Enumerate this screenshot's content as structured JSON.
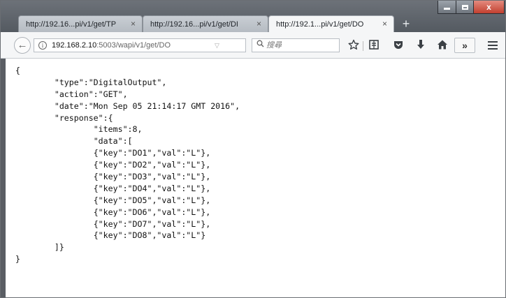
{
  "tabs": [
    {
      "label": "http://192.16...pi/v1/get/TP",
      "close": "×",
      "active": false
    },
    {
      "label": "http://192.16...pi/v1/get/DI",
      "close": "×",
      "active": false
    },
    {
      "label": "http://192.1...pi/v1/get/DO",
      "close": "×",
      "active": true
    }
  ],
  "new_tab": "+",
  "window_controls": {
    "close": "x"
  },
  "navbar": {
    "back": "←",
    "url_host": "192.168.2.10",
    "url_rest": ":5003/wapi/v1/get/DO",
    "url_dropdown": "▽",
    "reload": "C",
    "search_placeholder": "搜尋",
    "overflow": "»"
  },
  "icons": {
    "back": "back-arrow-icon",
    "info": "info-icon",
    "search": "search-icon",
    "bookmark": "star-icon",
    "reading_list": "reading-list-icon",
    "pocket": "pocket-icon",
    "download": "download-icon",
    "home": "home-icon",
    "menu": "hamburger-menu-icon"
  },
  "json_lines": [
    "{",
    "\t\"type\":\"DigitalOutput\",",
    "\t\"action\":\"GET\",",
    "\t\"date\":\"Mon Sep 05 21:14:17 GMT 2016\",",
    "\t\"response\":{",
    "\t\t\"items\":8,",
    "\t\t\"data\":[",
    "\t\t{\"key\":\"DO1\",\"val\":\"L\"},",
    "\t\t{\"key\":\"DO2\",\"val\":\"L\"},",
    "\t\t{\"key\":\"DO3\",\"val\":\"L\"},",
    "\t\t{\"key\":\"DO4\",\"val\":\"L\"},",
    "\t\t{\"key\":\"DO5\",\"val\":\"L\"},",
    "\t\t{\"key\":\"DO6\",\"val\":\"L\"},",
    "\t\t{\"key\":\"DO7\",\"val\":\"L\"},",
    "\t\t{\"key\":\"DO8\",\"val\":\"L\"}",
    "\t]}",
    "}"
  ]
}
